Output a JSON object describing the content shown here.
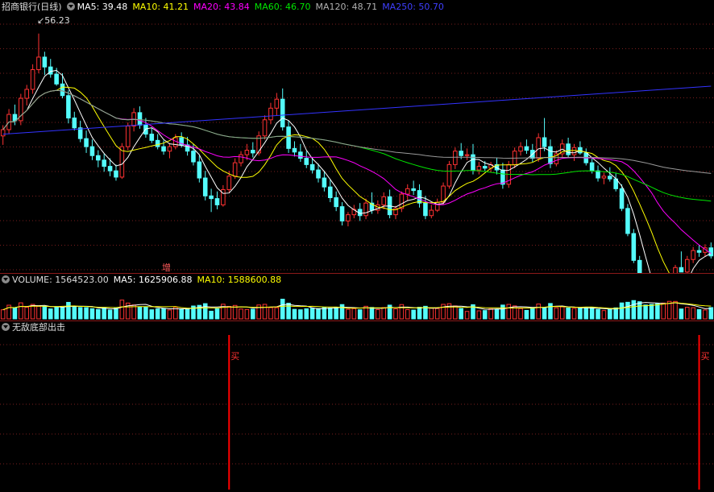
{
  "price_header": {
    "title": "招商银行(日线)",
    "ma5": "MA5: 39.48",
    "ma10": "MA10: 41.21",
    "ma20": "MA20: 43.84",
    "ma60": "MA60: 46.70",
    "ma120": "MA120: 48.71",
    "ma250": "MA250: 50.70"
  },
  "high_marker": "56.23",
  "event_marker": "增",
  "volume_header": {
    "volume": "VOLUME: 1564523.00",
    "ma5": "MA5: 1625906.88",
    "ma10": "MA10: 1588600.88"
  },
  "indicator_header": {
    "title": "无敌底部出击"
  },
  "buy_signals": [
    {
      "label": "买",
      "bar_index": 38
    },
    {
      "label": "买",
      "bar_index": 117
    }
  ],
  "colors": {
    "up": "#ff3232",
    "down": "#54fcfc",
    "ma5": "#ffffff",
    "ma10": "#ffff00",
    "ma20": "#ff00ff",
    "ma60": "#00e600",
    "ma120": "#9a9a9a",
    "ma250": "#3333ff",
    "grid": "#7a1e1e",
    "separator": "#8c1a1a",
    "header_default": "#dddddd"
  },
  "chart_data": {
    "type": "candlestick",
    "ylim": [
      33,
      58
    ],
    "candles": [
      [
        44.8,
        46.0,
        43.8,
        45.5
      ],
      [
        45.5,
        47.8,
        45.0,
        47.2
      ],
      [
        47.2,
        48.3,
        46.0,
        46.5
      ],
      [
        46.5,
        49.5,
        46.0,
        49.0
      ],
      [
        49.0,
        50.5,
        48.2,
        50.0
      ],
      [
        50.0,
        52.8,
        49.5,
        52.2
      ],
      [
        52.2,
        56.23,
        51.8,
        53.6
      ],
      [
        53.6,
        54.2,
        51.6,
        52.5
      ],
      [
        52.5,
        53.4,
        51.3,
        51.7
      ],
      [
        51.7,
        52.4,
        50.4,
        50.6
      ],
      [
        50.6,
        51.8,
        49.0,
        49.3
      ],
      [
        49.3,
        49.9,
        46.2,
        46.8
      ],
      [
        46.8,
        47.5,
        45.4,
        45.7
      ],
      [
        45.7,
        46.5,
        44.1,
        44.5
      ],
      [
        44.5,
        45.4,
        42.9,
        43.6
      ],
      [
        43.6,
        44.4,
        42.1,
        42.6
      ],
      [
        42.6,
        43.2,
        41.3,
        42.1
      ],
      [
        42.1,
        42.8,
        40.8,
        41.4
      ],
      [
        41.4,
        42.3,
        40.3,
        40.9
      ],
      [
        40.9,
        41.6,
        39.8,
        40.2
      ],
      [
        40.2,
        44.0,
        40.0,
        43.6
      ],
      [
        43.6,
        46.3,
        43.2,
        45.9
      ],
      [
        45.9,
        47.9,
        45.3,
        47.4
      ],
      [
        47.4,
        48.1,
        45.6,
        46.0
      ],
      [
        46.0,
        46.8,
        44.6,
        45.0
      ],
      [
        45.0,
        45.7,
        44.0,
        44.3
      ],
      [
        44.3,
        45.0,
        43.3,
        43.6
      ],
      [
        43.6,
        44.3,
        42.7,
        43.1
      ],
      [
        43.1,
        44.0,
        42.3,
        43.6
      ],
      [
        43.6,
        45.0,
        43.3,
        44.6
      ],
      [
        44.6,
        45.2,
        43.5,
        43.8
      ],
      [
        43.8,
        44.7,
        42.6,
        43.1
      ],
      [
        43.1,
        43.9,
        41.5,
        41.9
      ],
      [
        41.9,
        42.6,
        39.6,
        40.1
      ],
      [
        40.1,
        40.9,
        37.6,
        38.1
      ],
      [
        38.1,
        38.9,
        36.3,
        37.8
      ],
      [
        37.8,
        38.6,
        36.6,
        37.1
      ],
      [
        37.1,
        39.3,
        36.9,
        38.8
      ],
      [
        38.8,
        40.9,
        38.5,
        40.3
      ],
      [
        40.3,
        42.3,
        40.0,
        41.8
      ],
      [
        41.8,
        43.1,
        41.4,
        42.7
      ],
      [
        42.7,
        43.9,
        42.1,
        43.2
      ],
      [
        43.2,
        44.1,
        42.4,
        42.9
      ],
      [
        42.9,
        45.3,
        42.6,
        44.8
      ],
      [
        44.8,
        47.1,
        44.4,
        46.6
      ],
      [
        46.6,
        48.5,
        46.1,
        47.9
      ],
      [
        47.9,
        49.6,
        47.1,
        48.9
      ],
      [
        48.9,
        50.1,
        45.4,
        45.8
      ],
      [
        45.8,
        46.5,
        42.9,
        43.4
      ],
      [
        43.4,
        44.2,
        42.5,
        43.0
      ],
      [
        43.0,
        43.9,
        41.9,
        42.3
      ],
      [
        42.3,
        43.1,
        41.2,
        41.6
      ],
      [
        41.6,
        42.4,
        40.6,
        41.0
      ],
      [
        41.0,
        41.7,
        39.6,
        40.1
      ],
      [
        40.1,
        40.9,
        38.6,
        39.1
      ],
      [
        39.1,
        39.9,
        37.4,
        37.9
      ],
      [
        37.9,
        38.6,
        36.4,
        36.9
      ],
      [
        36.9,
        37.4,
        34.8,
        35.3
      ],
      [
        35.3,
        36.3,
        34.7,
        36.0
      ],
      [
        36.0,
        37.1,
        35.6,
        36.6
      ],
      [
        36.6,
        37.3,
        35.3,
        35.9
      ],
      [
        35.9,
        37.8,
        35.5,
        37.3
      ],
      [
        37.3,
        38.5,
        36.1,
        36.5
      ],
      [
        36.5,
        37.6,
        36.1,
        37.1
      ],
      [
        37.1,
        38.5,
        36.6,
        38.0
      ],
      [
        38.0,
        38.8,
        35.6,
        36.0
      ],
      [
        36.0,
        37.0,
        35.5,
        36.7
      ],
      [
        36.7,
        38.6,
        36.3,
        38.3
      ],
      [
        38.3,
        39.4,
        37.6,
        38.9
      ],
      [
        38.9,
        39.8,
        38.2,
        38.7
      ],
      [
        38.7,
        39.4,
        36.8,
        37.3
      ],
      [
        37.3,
        38.1,
        35.5,
        35.9
      ],
      [
        35.9,
        37.1,
        35.6,
        36.5
      ],
      [
        36.5,
        37.8,
        36.3,
        37.4
      ],
      [
        37.4,
        39.6,
        37.1,
        39.2
      ],
      [
        39.2,
        42.0,
        38.9,
        41.6
      ],
      [
        41.6,
        43.5,
        41.1,
        43.1
      ],
      [
        43.1,
        44.0,
        42.2,
        42.6
      ],
      [
        42.6,
        43.4,
        42.1,
        42.7
      ],
      [
        42.7,
        43.9,
        40.5,
        41.0
      ],
      [
        41.0,
        41.9,
        40.5,
        41.4
      ],
      [
        41.4,
        42.0,
        40.9,
        41.2
      ],
      [
        41.2,
        41.9,
        40.7,
        41.6
      ],
      [
        41.6,
        42.4,
        40.5,
        41.0
      ],
      [
        41.0,
        41.8,
        38.9,
        39.4
      ],
      [
        39.4,
        42.0,
        39.0,
        41.6
      ],
      [
        41.6,
        43.5,
        41.2,
        43.1
      ],
      [
        43.1,
        44.1,
        42.6,
        43.6
      ],
      [
        43.6,
        44.4,
        42.8,
        43.2
      ],
      [
        43.2,
        43.9,
        41.9,
        42.3
      ],
      [
        42.3,
        45.1,
        41.9,
        44.6
      ],
      [
        44.6,
        46.8,
        43.1,
        43.6
      ],
      [
        43.6,
        44.4,
        41.2,
        41.7
      ],
      [
        41.7,
        43.2,
        41.4,
        42.8
      ],
      [
        42.8,
        44.4,
        42.4,
        43.9
      ],
      [
        43.9,
        44.6,
        42.4,
        42.7
      ],
      [
        42.7,
        43.9,
        42.0,
        43.5
      ],
      [
        43.5,
        44.2,
        42.7,
        42.9
      ],
      [
        42.9,
        43.4,
        41.5,
        41.8
      ],
      [
        41.8,
        42.3,
        40.6,
        40.9
      ],
      [
        40.9,
        41.5,
        39.7,
        40.1
      ],
      [
        40.1,
        40.7,
        39.4,
        40.3
      ],
      [
        40.3,
        41.3,
        39.7,
        40.0
      ],
      [
        40.0,
        40.6,
        38.6,
        38.9
      ],
      [
        38.9,
        39.4,
        36.4,
        36.7
      ],
      [
        36.7,
        37.2,
        33.6,
        33.9
      ],
      [
        33.9,
        34.4,
        30.6,
        30.9
      ],
      [
        30.9,
        31.4,
        28.2,
        28.5
      ],
      [
        28.5,
        29.0,
        26.2,
        26.6
      ],
      [
        26.6,
        27.1,
        24.3,
        24.8
      ],
      [
        24.8,
        25.4,
        21.9,
        22.4
      ],
      [
        22.4,
        25.1,
        22.1,
        24.7
      ],
      [
        24.7,
        27.6,
        24.4,
        27.2
      ],
      [
        27.2,
        30.4,
        26.8,
        30.1
      ],
      [
        30.1,
        31.9,
        29.6,
        29.6
      ],
      [
        29.6,
        31.4,
        29.2,
        31.0
      ],
      [
        31.0,
        32.4,
        30.6,
        32.0
      ],
      [
        32.0,
        32.6,
        31.3,
        31.8
      ],
      [
        31.8,
        32.7,
        31.3,
        32.3
      ],
      [
        32.3,
        32.9,
        31.1,
        31.4
      ]
    ],
    "volume_ylim": [
      0,
      6000000
    ]
  }
}
